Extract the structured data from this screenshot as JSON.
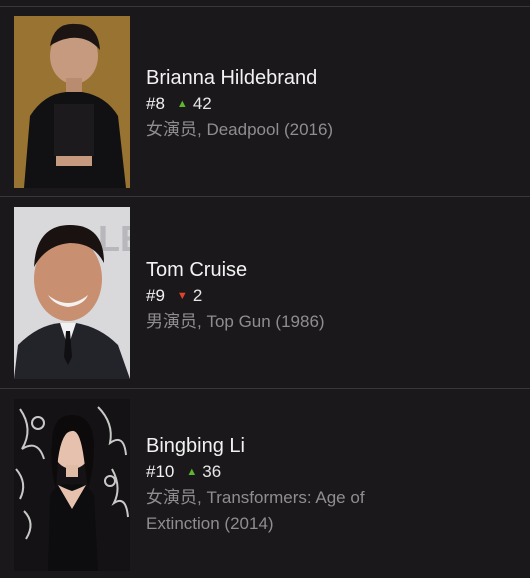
{
  "colors": {
    "background": "#1b181c",
    "divider": "#3a373b",
    "up": "#5cb82a",
    "down": "#e0432c",
    "meta": "#8f8d90"
  },
  "people": [
    {
      "name": "Brianna Hildebrand",
      "rank": "#8",
      "trend": "up",
      "trend_icon": "arrow-up-icon",
      "change": "42",
      "meta": "女演员, Deadpool (2016)"
    },
    {
      "name": "Tom Cruise",
      "rank": "#9",
      "trend": "down",
      "trend_icon": "arrow-down-icon",
      "change": "2",
      "meta": "男演员, Top Gun (1986)"
    },
    {
      "name": "Bingbing Li",
      "rank": "#10",
      "trend": "up",
      "trend_icon": "arrow-up-icon",
      "change": "36",
      "meta": "女演员, Transformers: Age of Extinction (2014)"
    }
  ]
}
